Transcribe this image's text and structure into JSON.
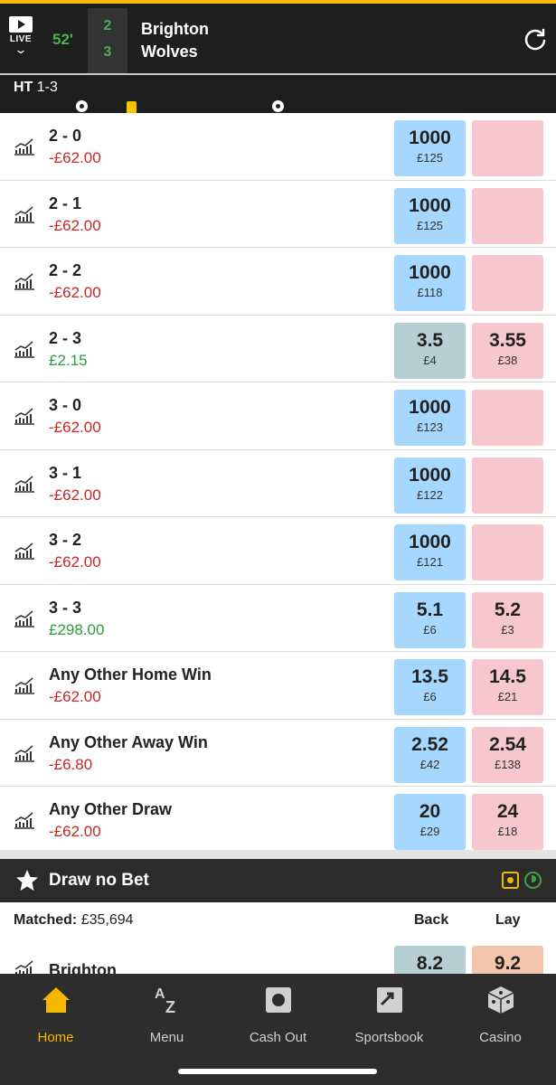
{
  "header": {
    "live_label": "LIVE",
    "minute": "52'",
    "home_score": "2",
    "away_score": "3",
    "home_team": "Brighton",
    "away_team": "Wolves",
    "ht_label": "HT",
    "ht_score": "1-3",
    "accent_color": "#f5b800",
    "timeline_progress": 0.58
  },
  "market_rows": [
    {
      "name": "2 - 0",
      "pl": "-£62.00",
      "pl_type": "neg",
      "back_odds": "1000",
      "back_stake": "£125",
      "lay_odds": "",
      "lay_stake": ""
    },
    {
      "name": "2 - 1",
      "pl": "-£62.00",
      "pl_type": "neg",
      "back_odds": "1000",
      "back_stake": "£125",
      "lay_odds": "",
      "lay_stake": ""
    },
    {
      "name": "2 - 2",
      "pl": "-£62.00",
      "pl_type": "neg",
      "back_odds": "1000",
      "back_stake": "£118",
      "lay_odds": "",
      "lay_stake": ""
    },
    {
      "name": "2 - 3",
      "pl": "£2.15",
      "pl_type": "pos",
      "back_odds": "3.5",
      "back_stake": "£4",
      "lay_odds": "3.55",
      "lay_stake": "£38",
      "matched": true
    },
    {
      "name": "3 - 0",
      "pl": "-£62.00",
      "pl_type": "neg",
      "back_odds": "1000",
      "back_stake": "£123",
      "lay_odds": "",
      "lay_stake": ""
    },
    {
      "name": "3 - 1",
      "pl": "-£62.00",
      "pl_type": "neg",
      "back_odds": "1000",
      "back_stake": "£122",
      "lay_odds": "",
      "lay_stake": ""
    },
    {
      "name": "3 - 2",
      "pl": "-£62.00",
      "pl_type": "neg",
      "back_odds": "1000",
      "back_stake": "£121",
      "lay_odds": "",
      "lay_stake": ""
    },
    {
      "name": "3 - 3",
      "pl": "£298.00",
      "pl_type": "pos",
      "back_odds": "5.1",
      "back_stake": "£6",
      "lay_odds": "5.2",
      "lay_stake": "£3"
    },
    {
      "name": "Any Other Home Win",
      "pl": "-£62.00",
      "pl_type": "neg",
      "back_odds": "13.5",
      "back_stake": "£6",
      "lay_odds": "14.5",
      "lay_stake": "£21"
    },
    {
      "name": "Any Other Away Win",
      "pl": "-£6.80",
      "pl_type": "neg",
      "back_odds": "2.52",
      "back_stake": "£42",
      "lay_odds": "2.54",
      "lay_stake": "£138"
    },
    {
      "name": "Any Other Draw",
      "pl": "-£62.00",
      "pl_type": "neg",
      "back_odds": "20",
      "back_stake": "£29",
      "lay_odds": "24",
      "lay_stake": "£18"
    }
  ],
  "draw_no_bet": {
    "title": "Draw no Bet",
    "matched_label": "Matched:",
    "matched_value": "£35,694",
    "back_header": "Back",
    "lay_header": "Lay",
    "row_name": "Brighton",
    "back_odds": "8.2",
    "lay_odds": "9.2"
  },
  "nav": [
    {
      "label": "Home",
      "icon": "home-icon",
      "active": true
    },
    {
      "label": "Menu",
      "icon": "az-icon",
      "active": false
    },
    {
      "label": "Cash Out",
      "icon": "cash-out-icon",
      "active": false
    },
    {
      "label": "Sportsbook",
      "icon": "sportsbook-icon",
      "active": false
    },
    {
      "label": "Casino",
      "icon": "dice-icon",
      "active": false
    }
  ]
}
